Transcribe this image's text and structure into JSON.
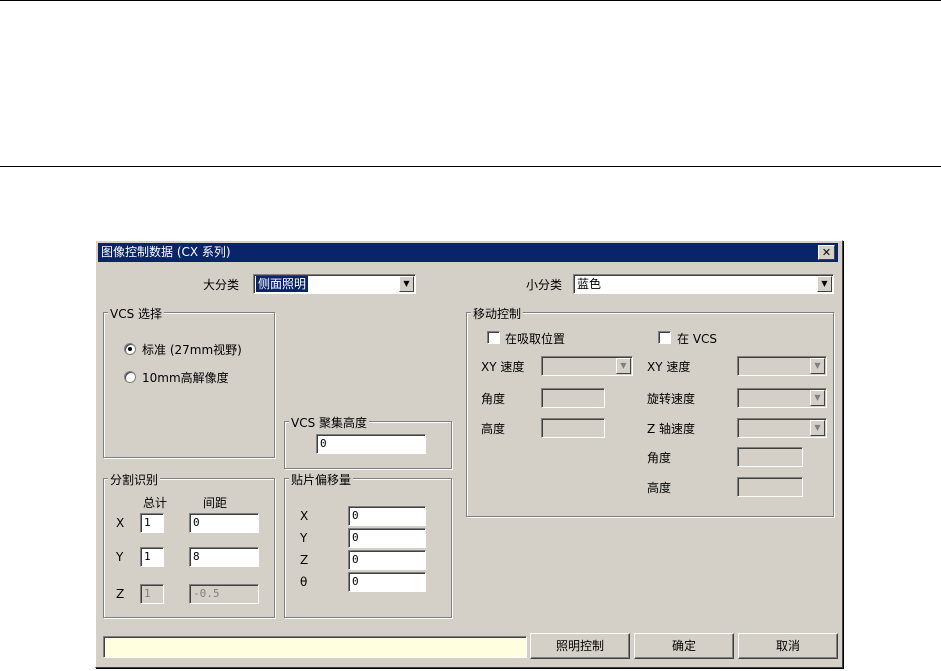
{
  "dialog": {
    "title": "图像控制数据 (CX 系列)",
    "close_glyph": "✕"
  },
  "category": {
    "major_label": "大分类",
    "major_value": "侧面照明",
    "minor_label": "小分类",
    "minor_value": "蓝色"
  },
  "vcs_select": {
    "legend": "VCS 选择",
    "options": [
      "标准 (27mm视野)",
      "10mm高解像度"
    ],
    "selected_index": 0
  },
  "focus_height": {
    "legend": "VCS 聚集高度",
    "value": "0"
  },
  "split_recog": {
    "legend": "分割识别",
    "col_total": "总计",
    "col_spacing": "间距",
    "rows": [
      {
        "axis": "X",
        "total": "1",
        "spacing": "0"
      },
      {
        "axis": "Y",
        "total": "1",
        "spacing": "8"
      },
      {
        "axis": "Z",
        "total": "1",
        "spacing": "-0.5"
      }
    ]
  },
  "mount_offset": {
    "legend": "贴片偏移量",
    "rows": [
      {
        "axis": "X",
        "value": "0"
      },
      {
        "axis": "Y",
        "value": "0"
      },
      {
        "axis": "Z",
        "value": "0"
      },
      {
        "axis": "θ",
        "value": "0"
      }
    ]
  },
  "move_control": {
    "legend": "移动控制",
    "check_pick": "在吸取位置",
    "check_vcs": "在 VCS",
    "left": {
      "xy_speed": "XY 速度",
      "angle": "角度",
      "height": "高度"
    },
    "right": {
      "xy_speed": "XY 速度",
      "rot_speed": "旋转速度",
      "z_speed": "Z 轴速度",
      "angle": "角度",
      "height": "高度"
    }
  },
  "buttons": {
    "light_control": "照明控制",
    "ok": "确定",
    "cancel": "取消"
  },
  "glyphs": {
    "dropdown": "▼"
  }
}
